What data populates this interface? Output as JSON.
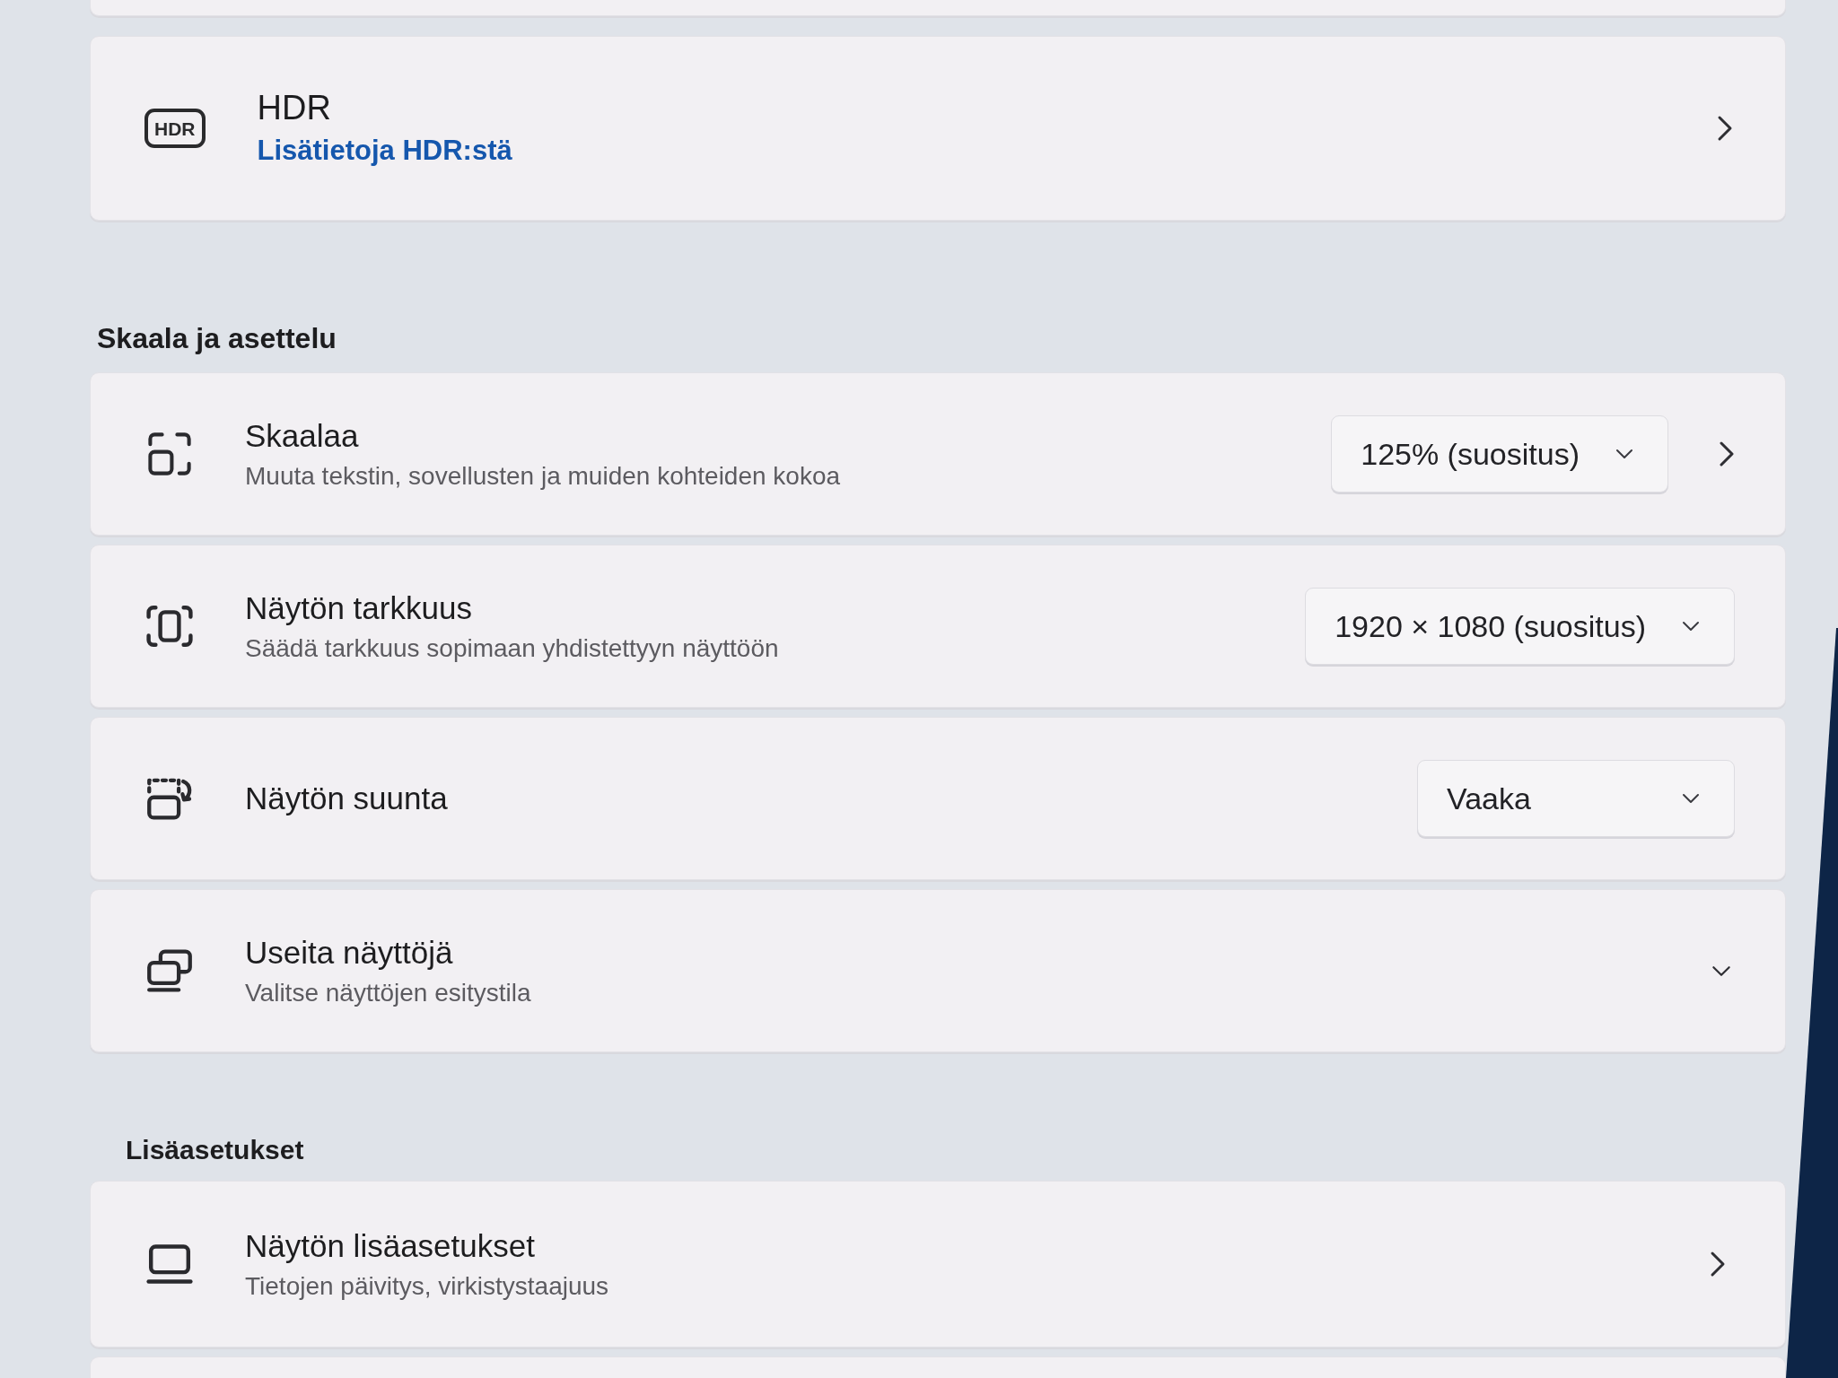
{
  "hdr_card": {
    "badge": "HDR",
    "title": "HDR",
    "link": "Lisätietoja HDR:stä"
  },
  "sections": [
    {
      "heading": "Skaala ja asettelu",
      "items": [
        {
          "kind": "dropdown_link",
          "title": "Skaalaa",
          "subtitle": "Muuta tekstin, sovellusten ja muiden kohteiden kokoa",
          "value": "125% (suositus)"
        },
        {
          "kind": "dropdown",
          "title": "Näytön tarkkuus",
          "subtitle": "Säädä tarkkuus sopimaan yhdistettyyn näyttöön",
          "value": "1920 × 1080 (suositus)"
        },
        {
          "kind": "dropdown",
          "title": "Näytön suunta",
          "value": "Vaaka"
        },
        {
          "kind": "expander",
          "title": "Useita näyttöjä",
          "subtitle": "Valitse näyttöjen esitystila",
          "expanded": false
        }
      ]
    },
    {
      "heading": "Lisäasetukset",
      "items": [
        {
          "kind": "link",
          "title": "Näytön lisäasetukset",
          "subtitle": "Tietojen päivitys, virkistystaajuus"
        }
      ]
    }
  ]
}
